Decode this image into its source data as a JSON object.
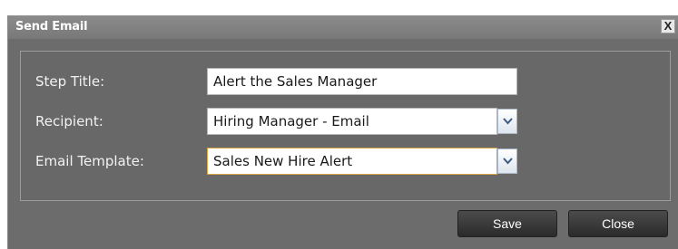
{
  "dialog": {
    "title": "Send Email",
    "close_glyph": "X"
  },
  "form": {
    "step_title_label": "Step Title:",
    "step_title_value": "Alert the Sales Manager",
    "recipient_label": "Recipient:",
    "recipient_value": "Hiring Manager - Email",
    "template_label": "Email Template:",
    "template_value": "Sales New Hire Alert"
  },
  "buttons": {
    "save": "Save",
    "close": "Close"
  },
  "icons": {
    "close": "close-icon",
    "dropdown": "chevron-down-icon"
  },
  "colors": {
    "dialog_bg": "#6c6c6c",
    "focus_border": "#d9a441",
    "button_bg": "#333333"
  }
}
